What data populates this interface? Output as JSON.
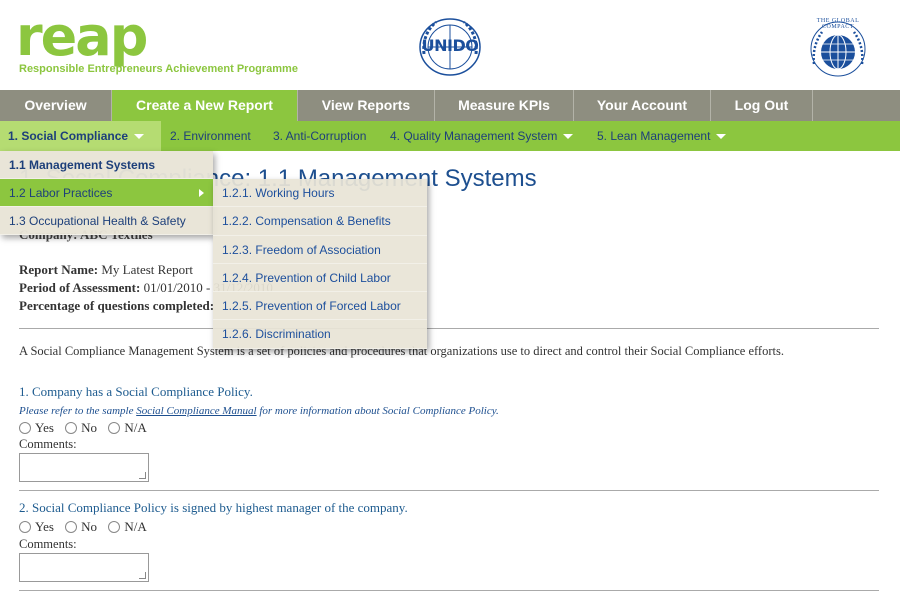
{
  "header": {
    "logo_text": "reap",
    "tagline": "Responsible Entrepreneurs Achievement Programme",
    "unido_text": "UNIDO",
    "global_compact_text": "THE GLOBAL COMPACT"
  },
  "main_nav": [
    {
      "label": "Overview",
      "active": false
    },
    {
      "label": "Create a New Report",
      "active": true
    },
    {
      "label": "View Reports",
      "active": false
    },
    {
      "label": "Measure KPIs",
      "active": false
    },
    {
      "label": "Your Account",
      "active": false
    },
    {
      "label": "Log Out",
      "active": false
    }
  ],
  "sub_nav": [
    {
      "label": "1. Social Compliance",
      "active": true
    },
    {
      "label": "2. Environment",
      "active": false
    },
    {
      "label": "3. Anti-Corruption",
      "active": false
    },
    {
      "label": "4. Quality Management System",
      "active": false
    },
    {
      "label": "5. Lean Management",
      "active": false
    }
  ],
  "dropdown": {
    "level1": [
      {
        "label": "1.1 Management Systems"
      },
      {
        "label": "1.2 Labor Practices"
      },
      {
        "label": "1.3 Occupational Health & Safety"
      }
    ],
    "level2": [
      {
        "label": "1.2.1. Working Hours"
      },
      {
        "label": "1.2.2. Compensation & Benefits"
      },
      {
        "label": "1.2.3. Freedom of Association"
      },
      {
        "label": "1.2.4. Prevention of Child Labor"
      },
      {
        "label": "1.2.5. Prevention of Forced Labor"
      },
      {
        "label": "1.2.6. Discrimination"
      }
    ]
  },
  "page": {
    "title": "1. Social Compliance: 1.1 Management Systems",
    "company_label": "Company: ABC Textiles",
    "report_name_label": "Report Name:",
    "report_name_value": "My Latest Report",
    "period_label": "Period of Assessment:",
    "period_value": "01/01/2010 - 31/12/2010",
    "percentage_label": "Percentage of questions completed:",
    "percentage_value": "",
    "intro": "A Social Compliance Management System is a set of policies and procedures that organizations use to direct and control their Social Compliance efforts."
  },
  "questions": [
    {
      "title": "1. Company has a Social Compliance Policy.",
      "note_before": "Please refer to the sample ",
      "note_link": "Social Compliance Manual",
      "note_after": " for more information about Social Compliance Policy.",
      "options": [
        "Yes",
        "No",
        "N/A"
      ],
      "comments_label": "Comments:"
    },
    {
      "title": "2. Social Compliance Policy is signed by highest manager of the company.",
      "options": [
        "Yes",
        "No",
        "N/A"
      ],
      "comments_label": "Comments:"
    }
  ],
  "colors": {
    "brand_green": "#8cc63f",
    "nav_gray": "#8e8e80",
    "title_blue": "#1d4f8f"
  }
}
